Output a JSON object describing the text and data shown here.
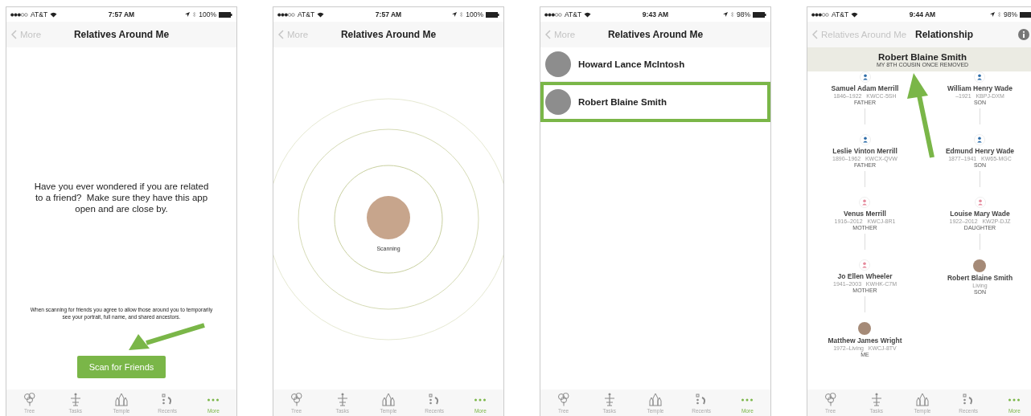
{
  "screens": [
    {
      "status": {
        "carrier": "AT&T",
        "time": "7:57 AM",
        "battery": "100%"
      },
      "nav": {
        "back": "More",
        "title": "Relatives Around Me"
      },
      "content": {
        "kind": "intro",
        "message": "Have you ever wondered if you are related to a friend?  Make sure they have this app open and are close by.",
        "notice": "When scanning for friends you agree to allow those around you to temporarily see your portrait, full name, and shared ancestors.",
        "button": "Scan for Friends"
      },
      "tabs": [
        {
          "label": "Tree",
          "selected": false
        },
        {
          "label": "Tasks",
          "selected": false
        },
        {
          "label": "Temple",
          "selected": false
        },
        {
          "label": "Recents",
          "selected": false
        },
        {
          "label": "More",
          "selected": true
        }
      ]
    },
    {
      "status": {
        "carrier": "AT&T",
        "time": "7:57 AM",
        "battery": "100%"
      },
      "nav": {
        "back": "More",
        "title": "Relatives Around Me"
      },
      "content": {
        "kind": "scanning",
        "label": "Scanning"
      },
      "tabs": [
        {
          "label": "Tree",
          "selected": false
        },
        {
          "label": "Tasks",
          "selected": false
        },
        {
          "label": "Temple",
          "selected": false
        },
        {
          "label": "Recents",
          "selected": false
        },
        {
          "label": "More",
          "selected": true
        }
      ]
    },
    {
      "status": {
        "carrier": "AT&T",
        "time": "9:43 AM",
        "battery": "98%"
      },
      "nav": {
        "back": "More",
        "title": "Relatives Around Me"
      },
      "content": {
        "kind": "list",
        "people": [
          {
            "name": "Howard Lance McIntosh",
            "selected": false
          },
          {
            "name": "Robert Blaine Smith",
            "selected": true
          }
        ]
      },
      "tabs": [
        {
          "label": "Tree",
          "selected": false
        },
        {
          "label": "Tasks",
          "selected": false
        },
        {
          "label": "Temple",
          "selected": false
        },
        {
          "label": "Recents",
          "selected": false
        },
        {
          "label": "More",
          "selected": true
        }
      ]
    },
    {
      "status": {
        "carrier": "AT&T",
        "time": "9:44 AM",
        "battery": "98%"
      },
      "nav": {
        "back": "Relatives Around Me",
        "title": "Relationship",
        "info_button": true
      },
      "content": {
        "kind": "relationship",
        "name": "Robert Blaine Smith",
        "relationship": "MY 8TH COUSIN ONCE REMOVED",
        "columns": [
          [
            {
              "kind": "male",
              "name": "Samuel Adam Merrill",
              "details": "1846–1922   KWCC-5SH",
              "relation": "FATHER"
            },
            {
              "kind": "male",
              "name": "Leslie Vinton Merrill",
              "details": "1890–1962   KWCX-QVW",
              "relation": "FATHER"
            },
            {
              "kind": "female",
              "name": "Venus Merrill",
              "details": "1916–2012   KWCJ-8R1",
              "relation": "MOTHER"
            },
            {
              "kind": "female",
              "name": "Jo Ellen Wheeler",
              "details": "1941–2003   KWHK-C7M",
              "relation": "MOTHER"
            },
            {
              "kind": "photo",
              "name": "Matthew James Wright",
              "details": "1972–Living   KWCJ-8TV",
              "relation": "ME"
            }
          ],
          [
            {
              "kind": "male",
              "name": "William Henry Wade",
              "details": "–1921   KBPJ-DXM",
              "relation": "SON"
            },
            {
              "kind": "male",
              "name": "Edmund Henry Wade",
              "details": "1877–1941   KW65-MGC",
              "relation": "SON"
            },
            {
              "kind": "female",
              "name": "Louise Mary Wade",
              "details": "1922–2012   KW2P-DJZ",
              "relation": "DAUGHTER"
            },
            {
              "kind": "photo",
              "name": "Robert Blaine Smith",
              "details": "Living",
              "relation": "SON"
            }
          ]
        ]
      },
      "tabs": [
        {
          "label": "Tree",
          "selected": false
        },
        {
          "label": "Tasks",
          "selected": false
        },
        {
          "label": "Temple",
          "selected": false
        },
        {
          "label": "Recents",
          "selected": false
        },
        {
          "label": "More",
          "selected": true
        }
      ]
    }
  ]
}
